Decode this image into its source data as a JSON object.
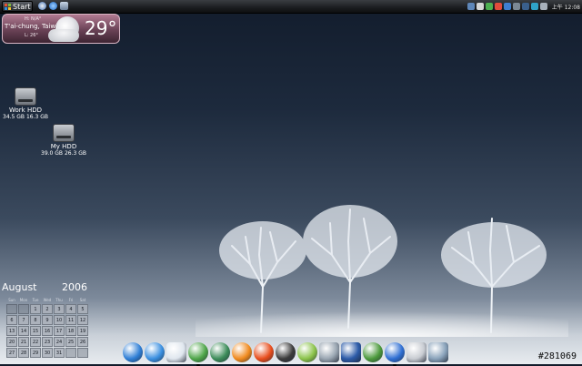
{
  "taskbar": {
    "start_label": "Start",
    "clock": "上午 12:08",
    "quicklaunch": [
      "windows-media-icon",
      "internet-explorer-icon",
      "desktop-icon"
    ],
    "tray_icons": [
      "network-icon",
      "volume-icon",
      "messenger-icon",
      "security-icon",
      "update-icon",
      "monitor-icon",
      "display-icon",
      "sync-icon",
      "power-icon"
    ]
  },
  "weather": {
    "high": "H: N/A°",
    "city": "T'ai-chung, Taiw",
    "low": "L: 26°",
    "temperature": "29°",
    "condition_icon": "moon-cloud-icon"
  },
  "desktop_icons": [
    {
      "label": "Work HDD",
      "sub": "34.5 GB 16.3 GB"
    },
    {
      "label": "My HDD",
      "sub": "39.0 GB 26.3 GB"
    }
  ],
  "calendar": {
    "month": "August",
    "year": "2006",
    "weekdays": [
      "Sun",
      "Mon",
      "Tue",
      "Wed",
      "Thu",
      "Fri",
      "Sat"
    ],
    "days": [
      "",
      "",
      "1",
      "2",
      "3",
      "4",
      "5",
      "6",
      "7",
      "8",
      "9",
      "10",
      "11",
      "12",
      "13",
      "14",
      "15",
      "16",
      "17",
      "18",
      "19",
      "20",
      "21",
      "22",
      "23",
      "24",
      "25",
      "26",
      "27",
      "28",
      "29",
      "30",
      "31",
      "",
      ""
    ]
  },
  "dock_items": [
    {
      "name": "safari-icon",
      "color": "#2f7fd6"
    },
    {
      "name": "internet-explorer-icon",
      "color": "#3a8fe0"
    },
    {
      "name": "mail-icon",
      "color": "#dfe6ee"
    },
    {
      "name": "messenger-icon",
      "color": "#4fa64a"
    },
    {
      "name": "feather-icon",
      "color": "#3d8d5a"
    },
    {
      "name": "media-icon",
      "color": "#f08a1e"
    },
    {
      "name": "firefox-icon",
      "color": "#e84d1c"
    },
    {
      "name": "itunes-icon",
      "color": "#3b3b3b"
    },
    {
      "name": "music-note-icon",
      "color": "#8bc34a"
    },
    {
      "name": "film-reel-icon",
      "color": "#9aa6b2"
    },
    {
      "name": "paint-icon",
      "color": "#2c5ba8"
    },
    {
      "name": "globe-icon",
      "color": "#4c9a3c"
    },
    {
      "name": "tools-icon",
      "color": "#2f6fd3"
    },
    {
      "name": "settings-icon",
      "color": "#c8ccd2"
    },
    {
      "name": "trash-icon",
      "color": "#8aa3bb"
    }
  ],
  "watermark": "#281069"
}
